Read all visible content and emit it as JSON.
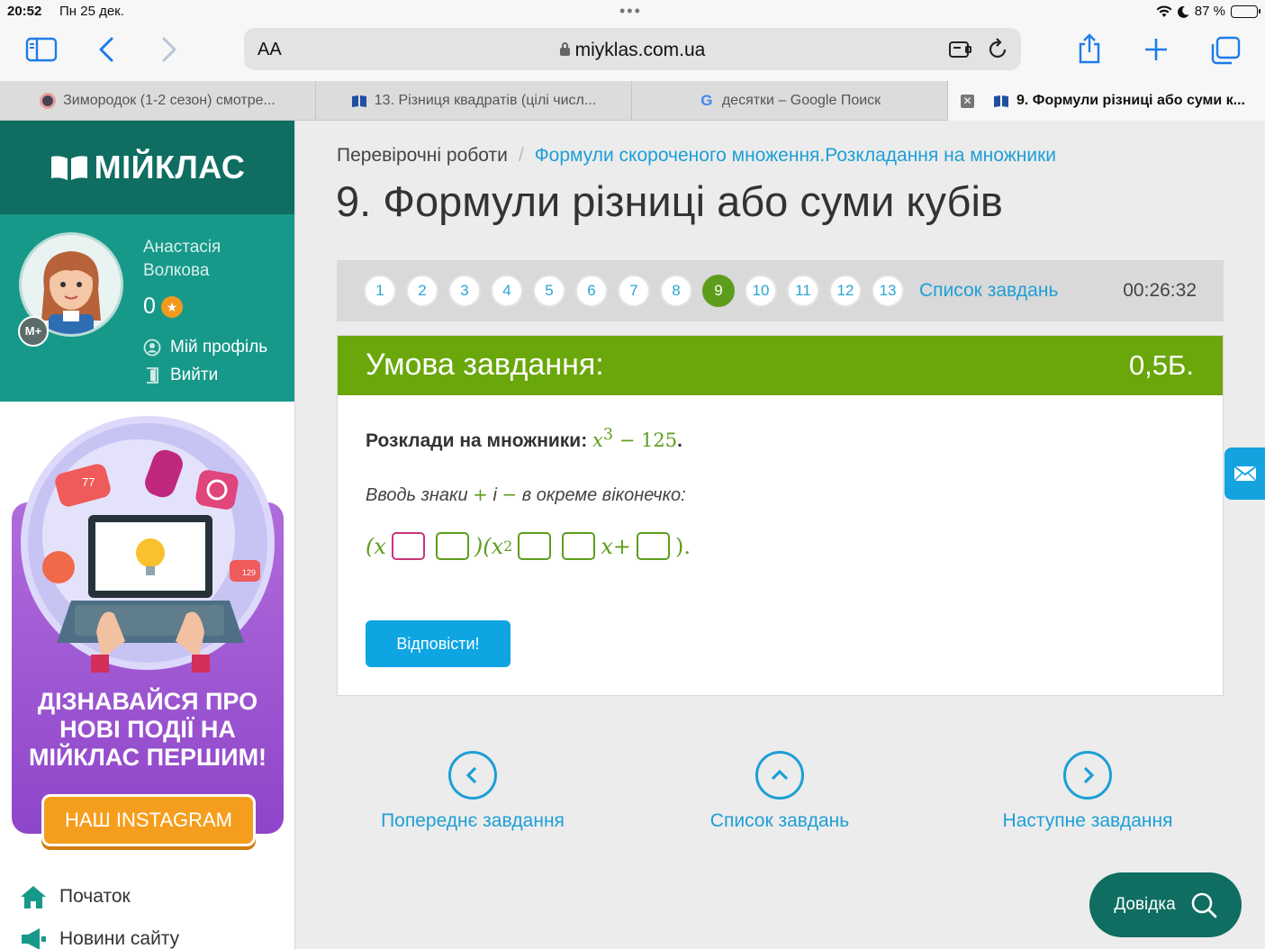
{
  "status": {
    "time": "20:52",
    "date": "Пн 25 дек.",
    "battery": "87 %",
    "battery_level": 0.87
  },
  "browser": {
    "aa": "AA",
    "url": "miyklas.com.ua",
    "tabs": [
      {
        "label": "Зимородок (1-2 сезон) смотре..."
      },
      {
        "label": "13. Різниця квадратів (цілі числ..."
      },
      {
        "label": "десятки – Google Поиск"
      },
      {
        "label": "9. Формули різниці або суми к..."
      }
    ]
  },
  "sidebar": {
    "logo": "МІЙКЛАС",
    "user_first": "Анастасія",
    "user_last": "Волкова",
    "points": "0",
    "badge": "M+",
    "profile_link": "Мій профіль",
    "logout_link": "Вийти",
    "promo_text": "ДІЗНАВАЙСЯ ПРО НОВІ ПОДІЇ НА МІЙКЛАС ПЕРШИМ!",
    "promo_button": "НАШ INSTAGRAM",
    "promo_badges": [
      "77",
      "129"
    ],
    "nav": [
      "Початок",
      "Новини сайту"
    ]
  },
  "main": {
    "breadcrumb_root": "Перевірочні роботи",
    "breadcrumb_sep": "/",
    "breadcrumb_link": "Формули скороченого множення.Розкладання на множники",
    "title": "9. Формули різниці або суми кубів",
    "pages": [
      "1",
      "2",
      "3",
      "4",
      "5",
      "6",
      "7",
      "8",
      "9",
      "10",
      "11",
      "12",
      "13"
    ],
    "current_page": "9",
    "task_list": "Список завдань",
    "timer": "00:26:32",
    "card_header": "Умова завдання:",
    "score": "0,5Б.",
    "q_label": "Розклади на множники:",
    "q_expr_base": "x",
    "q_expr_exp": "3",
    "q_expr_rest": " − 125",
    "q_expr_end": ".",
    "hint_before": "Вводь знаки ",
    "hint_plus": "+",
    "hint_mid": " і ",
    "hint_minus": "−",
    "hint_after": " в окреме віконечко:",
    "expr": {
      "open": "(x",
      "mid": ")(x",
      "exp": "2",
      "x_plus": "x+",
      "close": ")."
    },
    "answer_button": "Відповісти!",
    "prev": "Попереднє завдання",
    "list": "Список завдань",
    "next": "Наступне завдання",
    "help": "Довідка"
  },
  "colors": {
    "teal_dark": "#0f6d61",
    "teal": "#17998a",
    "green": "#6aa70a",
    "blue": "#1d9fd6",
    "answer_blue": "#0ea5e2"
  }
}
